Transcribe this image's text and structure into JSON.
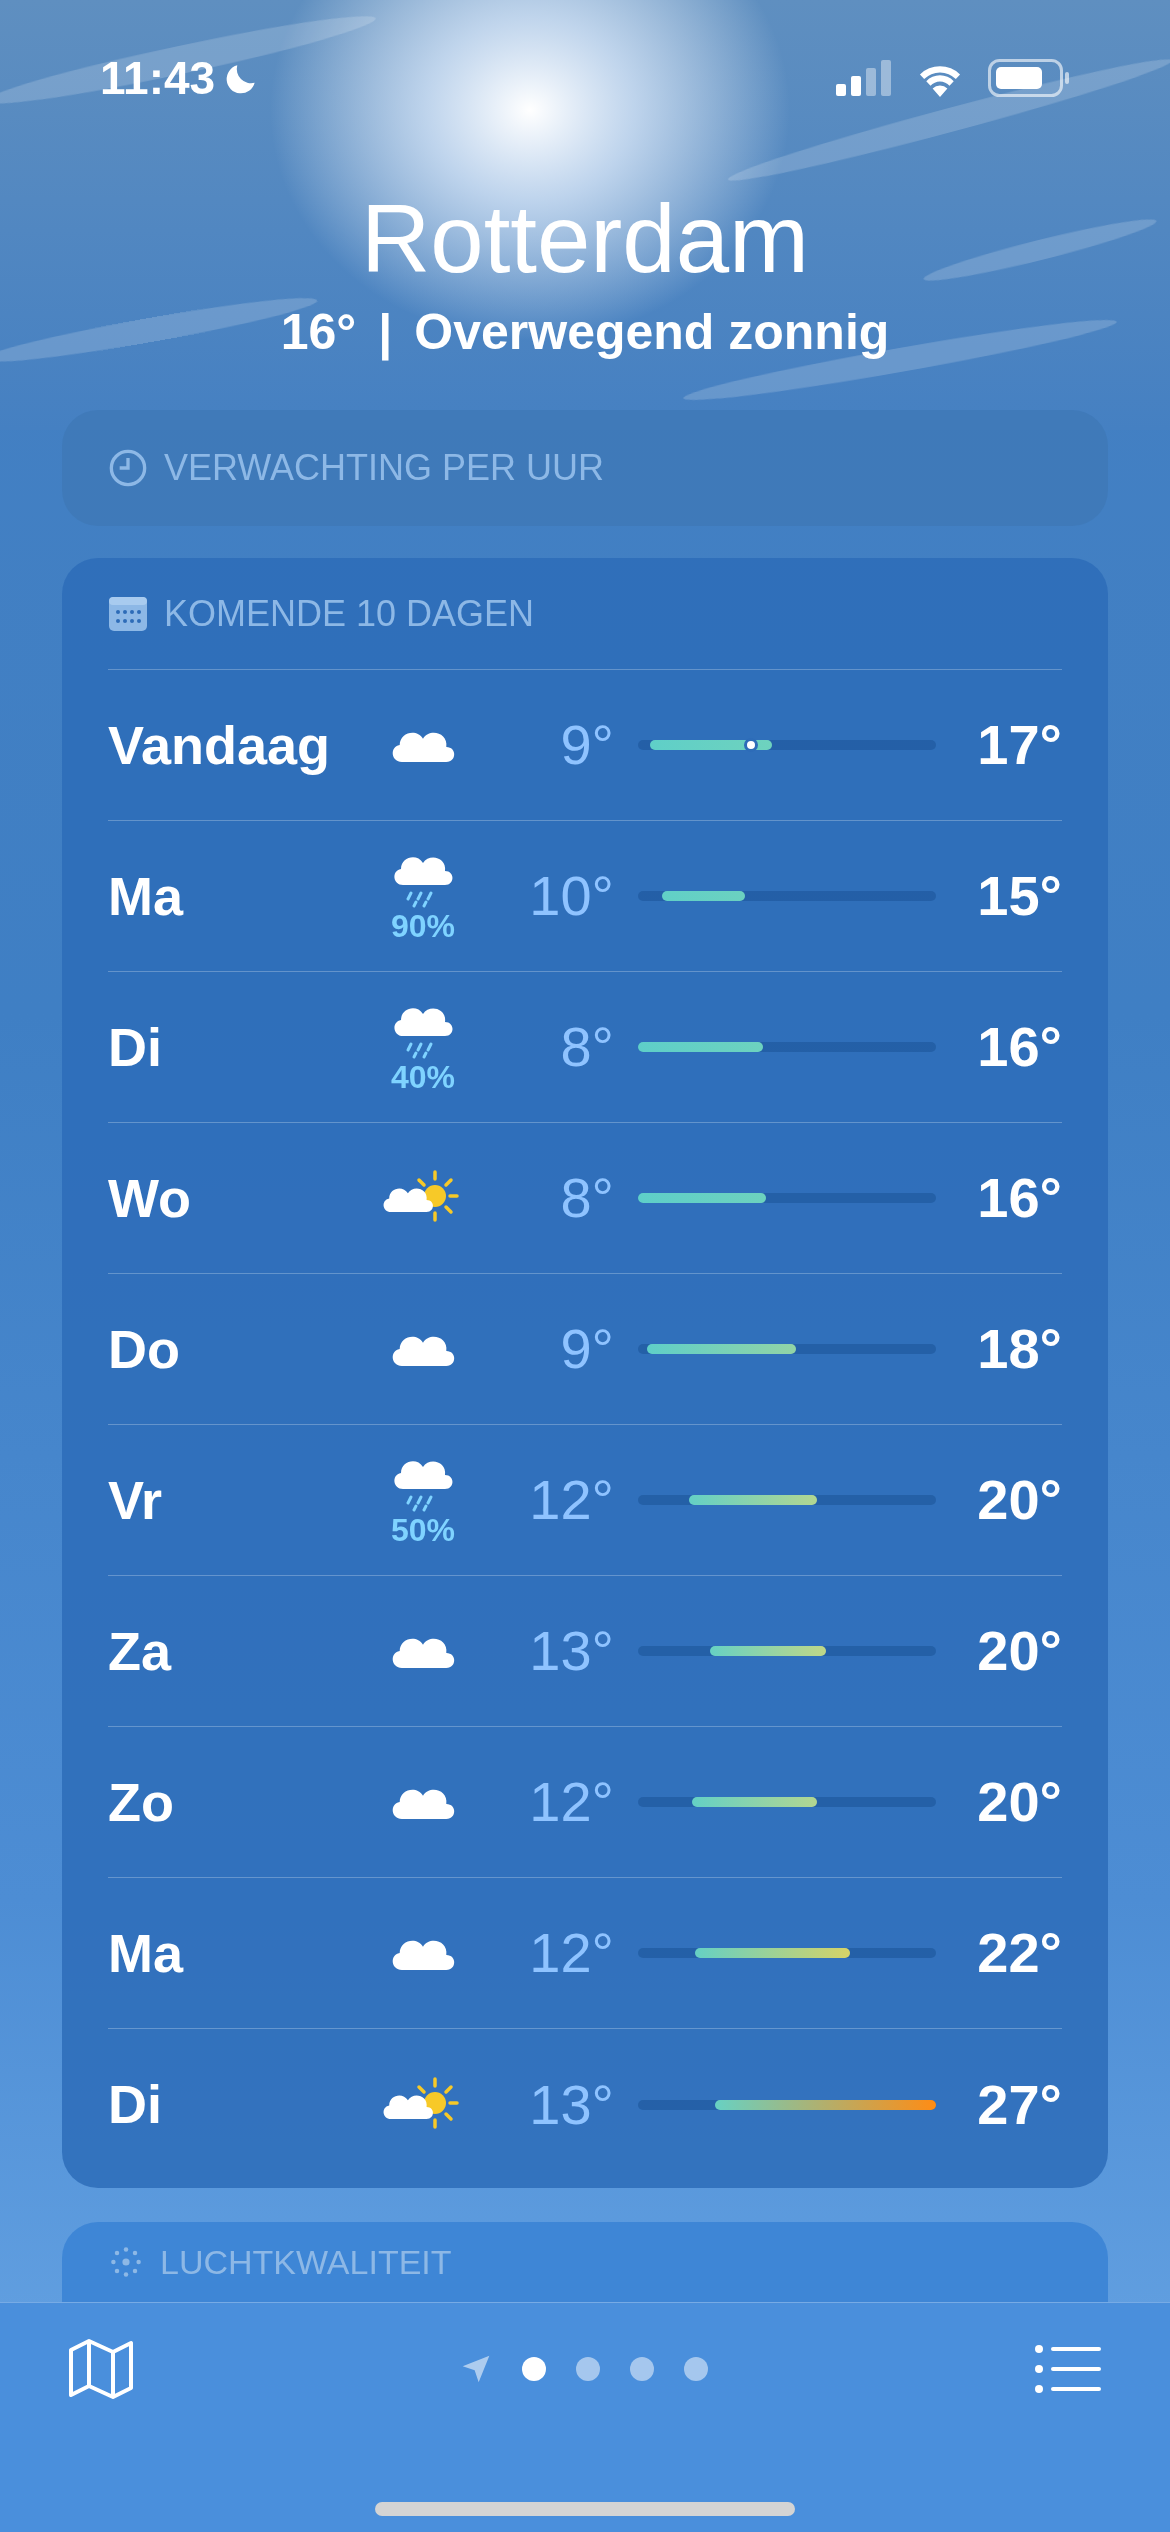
{
  "status_bar": {
    "time": "11:43"
  },
  "header": {
    "city": "Rotterdam",
    "temperature": "16°",
    "separator": "|",
    "condition": "Overwegend zonnig"
  },
  "hourly": {
    "title": "VERWACHTING PER UUR"
  },
  "forecast": {
    "title": "KOMENDE 10 DAGEN",
    "days": [
      {
        "day": "Vandaag",
        "kind": "cloudy",
        "low": "9°",
        "high": "17°"
      },
      {
        "day": "Ma",
        "kind": "rain",
        "precipitation": "90%",
        "low": "10°",
        "high": "15°"
      },
      {
        "day": "Di",
        "kind": "rain",
        "precipitation": "40%",
        "low": "8°",
        "high": "16°"
      },
      {
        "day": "Wo",
        "kind": "partly_sunny",
        "low": "8°",
        "high": "16°"
      },
      {
        "day": "Do",
        "kind": "cloudy",
        "low": "9°",
        "high": "18°"
      },
      {
        "day": "Vr",
        "kind": "rain",
        "precipitation": "50%",
        "low": "12°",
        "high": "20°"
      },
      {
        "day": "Za",
        "kind": "cloudy",
        "low": "13°",
        "high": "20°"
      },
      {
        "day": "Zo",
        "kind": "cloudy",
        "low": "12°",
        "high": "20°"
      },
      {
        "day": "Ma",
        "kind": "cloudy",
        "low": "12°",
        "high": "22°"
      },
      {
        "day": "Di",
        "kind": "partly_sunny",
        "low": "13°",
        "high": "27°"
      }
    ]
  },
  "air_quality": {
    "title": "LUCHTKWALITEIT"
  },
  "page_dots": [
    {
      "selected": true
    },
    {
      "selected": false
    },
    {
      "selected": false
    },
    {
      "selected": false
    }
  ]
}
